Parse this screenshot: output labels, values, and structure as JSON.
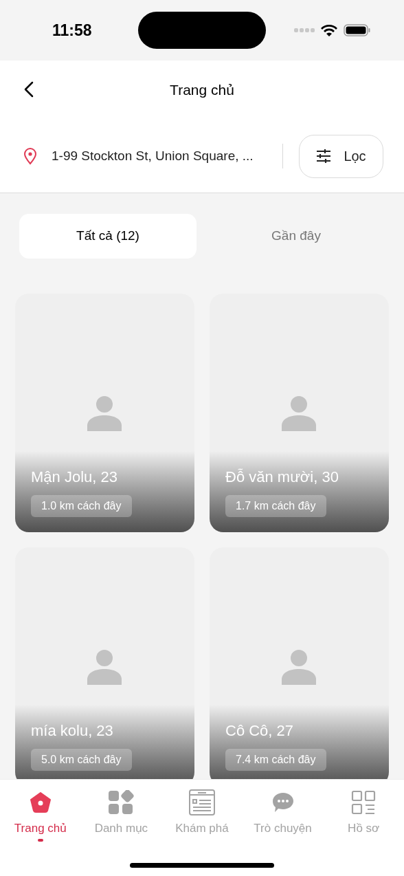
{
  "status_bar": {
    "time": "11:58"
  },
  "header": {
    "title": "Trang chủ"
  },
  "location": {
    "address": "1-99 Stockton St, Union Square, ...",
    "filter_label": "Lọc"
  },
  "tabs": [
    {
      "label": "Tất cả (12)",
      "selected": true
    },
    {
      "label": "Gần đây",
      "selected": false
    }
  ],
  "profiles": [
    {
      "name": "Mận Jolu, 23",
      "distance": "1.0 km cách đây"
    },
    {
      "name": "Đỗ văn mười, 30",
      "distance": "1.7 km cách đây"
    },
    {
      "name": "mía kolu, 23",
      "distance": "5.0 km cách đây"
    },
    {
      "name": "Cô Cô, 27",
      "distance": "7.4 km cách đây"
    }
  ],
  "bottom_nav": [
    {
      "kind": "home",
      "label": "Trang chủ",
      "selected": true
    },
    {
      "kind": "categories",
      "label": "Danh mục",
      "selected": false
    },
    {
      "kind": "explore",
      "label": "Khám phá",
      "selected": false
    },
    {
      "kind": "chat",
      "label": "Trò chuyện",
      "selected": false
    },
    {
      "kind": "profile",
      "label": "Hồ sơ",
      "selected": false
    }
  ]
}
